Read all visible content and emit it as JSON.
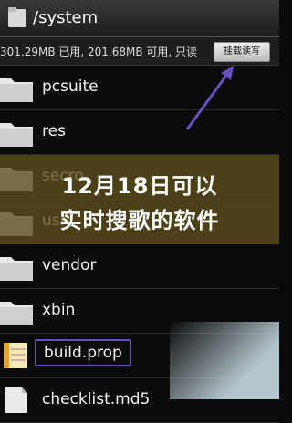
{
  "header": {
    "path": "/system"
  },
  "info_bar": {
    "text": "301.29MB 已用, 201.68MB 可用, 只读",
    "mount_button": "挂载读写"
  },
  "files": [
    {
      "name": "pcsuite",
      "icon": "folder-icon"
    },
    {
      "name": "res",
      "icon": "folder-icon"
    },
    {
      "name": "secro",
      "icon": "folder-icon"
    },
    {
      "name": "usr",
      "icon": "folder-icon"
    },
    {
      "name": "vendor",
      "icon": "folder-icon"
    },
    {
      "name": "xbin",
      "icon": "folder-icon"
    },
    {
      "name": "build.prop",
      "icon": "text-file-icon"
    },
    {
      "name": "checklist.md5",
      "icon": "file-icon"
    }
  ],
  "banner": {
    "line1": "12月18日可以",
    "line2": "实时搜歌的软件"
  },
  "colors": {
    "highlight": "#6a4fc1",
    "banner": "#5f501e"
  }
}
